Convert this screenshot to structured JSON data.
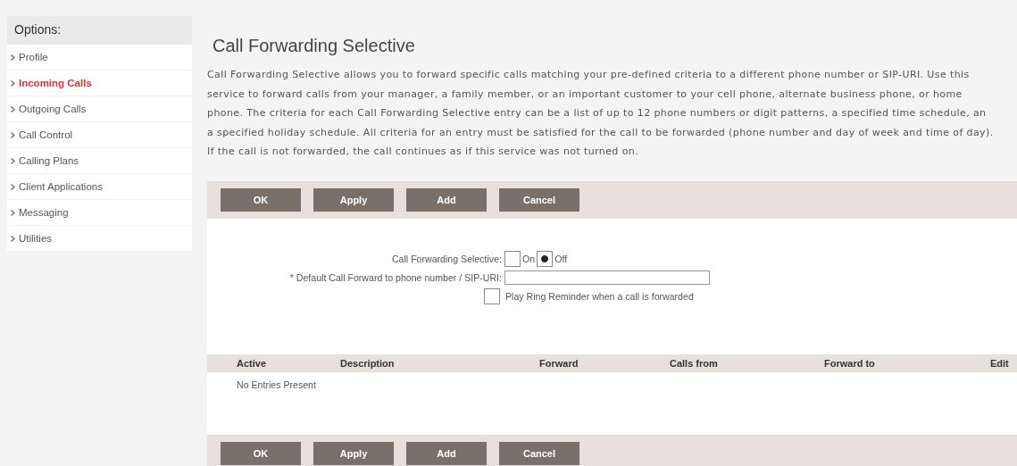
{
  "sidebar": {
    "title": "Options:",
    "items": [
      {
        "label": "Profile",
        "selected": false
      },
      {
        "label": "Incoming Calls",
        "selected": true
      },
      {
        "label": "Outgoing Calls",
        "selected": false
      },
      {
        "label": "Call Control",
        "selected": false
      },
      {
        "label": "Calling Plans",
        "selected": false
      },
      {
        "label": "Client Applications",
        "selected": false
      },
      {
        "label": "Messaging",
        "selected": false
      },
      {
        "label": "Utilities",
        "selected": false
      }
    ]
  },
  "title": "Call Forwarding Selective",
  "description_lines": [
    "Call Forwarding Selective allows you to forward specific calls matching your pre-defined criteria to a different phone number or SIP-URI. Use this",
    "service to forward calls from your manager, a family member, or an important customer to your cell phone, alternate business phone, or home",
    "phone. The criteria for each Call Forwarding Selective entry can be a list of up to 12 phone numbers or digit patterns, a specified time schedule, an",
    "a specified holiday schedule. All criteria for an entry must be satisfied for the call to be forwarded (phone number and day of week and time of day).",
    "If the call is not forwarded, the call continues as if this service was not turned on."
  ],
  "top_buttons": [
    "OK",
    "Apply",
    "Add",
    "Cancel"
  ],
  "form": {
    "selective_label": "Call Forwarding Selective:",
    "options": [
      {
        "label": "On",
        "selected": false
      },
      {
        "label": "Off",
        "selected": true
      }
    ],
    "forward_label": "* Default Call Forward to phone number / SIP-URI:",
    "reminder": {
      "label": "Play Ring Reminder when a call is forwarded",
      "checked": false
    }
  },
  "table": {
    "columns": [
      "Active",
      "Description",
      "Forward",
      "Calls from",
      "Forward to",
      "Edit"
    ],
    "empty_text": "No Entries Present"
  },
  "bottom_buttons": [
    "OK",
    "Apply",
    "Add",
    "Cancel"
  ]
}
